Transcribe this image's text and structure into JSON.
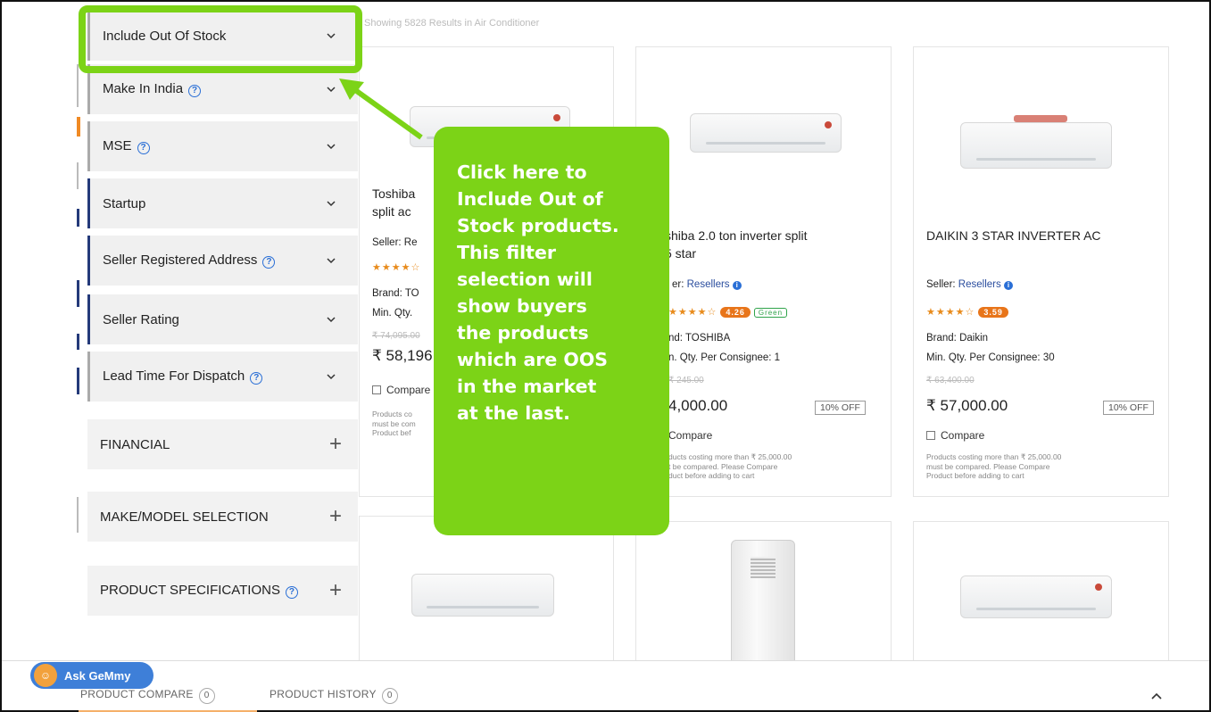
{
  "results_text": "Showing 5828 Results in Air Conditioner",
  "filters": [
    {
      "label": "Include Out Of Stock",
      "help": false
    },
    {
      "label": "Make In India",
      "help": true
    },
    {
      "label": "MSE",
      "help": true
    },
    {
      "label": "Startup",
      "help": false
    },
    {
      "label": "Seller Registered Address",
      "help": true
    },
    {
      "label": "Seller Rating",
      "help": false
    },
    {
      "label": "Lead Time For Dispatch",
      "help": true
    }
  ],
  "sections": [
    {
      "label": "FINANCIAL"
    },
    {
      "label": "MAKE/MODEL SELECTION"
    },
    {
      "label": "PRODUCT SPECIFICATIONS"
    }
  ],
  "callout": {
    "lines": [
      "Click here to",
      "Include Out of",
      "Stock products.",
      "This filter",
      "selection will",
      "show buyers",
      "the products",
      "which are OOS",
      "in the market",
      "at the last."
    ]
  },
  "products": [
    {
      "title_1": "Toshiba",
      "title_2": "split ac",
      "seller_label": "Seller: Re",
      "brand": "Brand: TO",
      "min_qty": "Min. Qty.",
      "mrp": "₹ 74,095.00",
      "price": "₹ 58,196",
      "compare": "Compare",
      "note_1": "Products co",
      "note_2": "must be com",
      "note_3": "Product bef"
    },
    {
      "title_1": "shiba 2.0 ton inverter split",
      "title_2": "5 star",
      "seller_label": "er: ",
      "seller_name": "Resellers",
      "rating": "4.26",
      "badge": "Green",
      "brand": "nd: TOSHIBA",
      "min_qty": "n. Qty. Per Consignee: 1",
      "mrp": "₹ 245.00",
      "price": "4,000.00",
      "off": "10% OFF",
      "compare": "Compare",
      "note_1": "ducts costing more than ₹ 25,000.00",
      "note_2": "t be compared. Please Compare",
      "note_3": "duct before adding to cart"
    },
    {
      "title_1": "DAIKIN 3 STAR INVERTER AC",
      "seller_label": "Seller: ",
      "seller_name": "Resellers",
      "rating": "3.59",
      "brand": "Brand: Daikin",
      "min_qty": "Min. Qty. Per Consignee: 30",
      "mrp": "₹ 63,400.00",
      "price": "₹ 57,000.00",
      "off": "10% OFF",
      "compare": "Compare",
      "note_1": "Products costing more than ₹ 25,000.00",
      "note_2": "must be compared. Please Compare",
      "note_3": "Product before adding to cart"
    }
  ],
  "stars": "★★★★☆",
  "gemmy_label": "Ask GeMmy",
  "bottom_bar": {
    "compare_label": "PRODUCT COMPARE",
    "compare_count": "0",
    "history_label": "PRODUCT HISTORY",
    "history_count": "0"
  },
  "colors": {
    "highlight": "#7cd317",
    "accent_blue": "#243a7a",
    "rating_orange": "#e8751a"
  }
}
